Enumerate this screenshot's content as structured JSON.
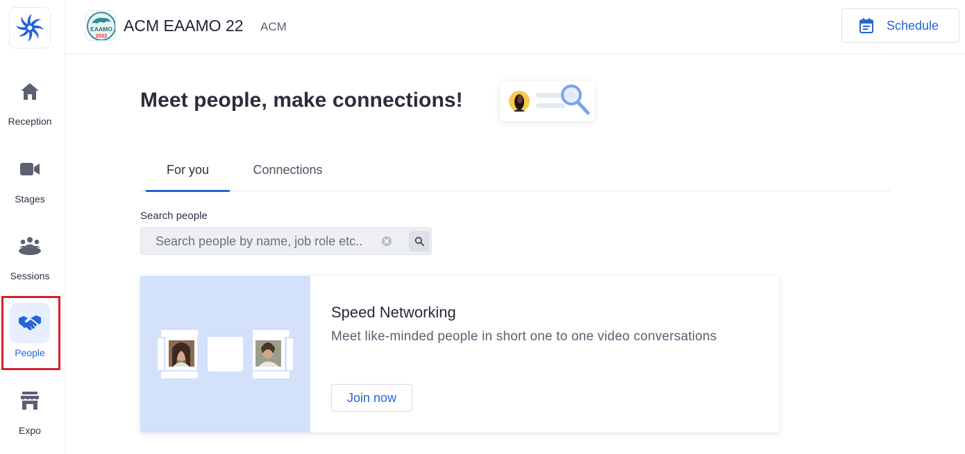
{
  "sidebar": {
    "items": [
      {
        "label": "Reception",
        "icon": "home-icon"
      },
      {
        "label": "Stages",
        "icon": "video-camera-icon"
      },
      {
        "label": "Sessions",
        "icon": "group-icon"
      },
      {
        "label": "People",
        "icon": "handshake-icon"
      },
      {
        "label": "Expo",
        "icon": "store-icon"
      }
    ],
    "active": "People"
  },
  "header": {
    "event_logo_text": "EAAMO 2022",
    "event_name": "ACM EAAMO 22",
    "organizer": "ACM",
    "schedule_label": "Schedule"
  },
  "main": {
    "title": "Meet people, make connections!",
    "tabs": [
      {
        "label": "For you",
        "active": true
      },
      {
        "label": "Connections",
        "active": false
      }
    ],
    "search": {
      "label": "Search people",
      "placeholder": "Search people by name, job role etc.."
    },
    "speed_networking": {
      "title": "Speed Networking",
      "description": "Meet like-minded people in short one to one video conversations",
      "button_label": "Join now"
    }
  },
  "colors": {
    "accent": "#2563d9",
    "active_bg": "#e7efff",
    "illustration_bg": "#d3e1fb",
    "highlight": "#d3202a"
  }
}
